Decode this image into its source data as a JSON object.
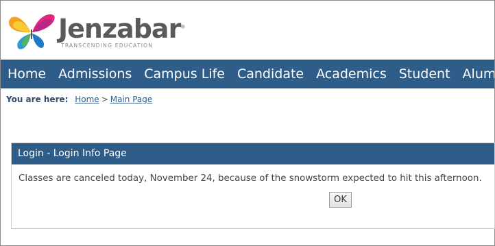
{
  "brand": {
    "name": "Jenzabar",
    "trademark": "®",
    "tagline": "TRANSCENDING EDUCATION"
  },
  "nav": {
    "items": [
      {
        "label": "Home"
      },
      {
        "label": "Admissions"
      },
      {
        "label": "Campus Life"
      },
      {
        "label": "Candidate"
      },
      {
        "label": "Academics"
      },
      {
        "label": "Student"
      },
      {
        "label": "Alumni"
      }
    ]
  },
  "breadcrumb": {
    "prefix": "You are here:",
    "items": [
      {
        "label": "Home"
      },
      {
        "label": "Main Page"
      }
    ],
    "separator": ">"
  },
  "panel": {
    "title": "Login - Login Info Page",
    "message": "Classes are canceled today, November 24, because of the snowstorm expected to hit this afternoon.",
    "ok_label": "OK"
  },
  "colors": {
    "nav_bg": "#2f5d8a",
    "panel_header_bg": "#2f5d8a",
    "breadcrumb_text": "#2f4a66"
  },
  "icons": {
    "logo": "butterfly-logo-icon"
  }
}
